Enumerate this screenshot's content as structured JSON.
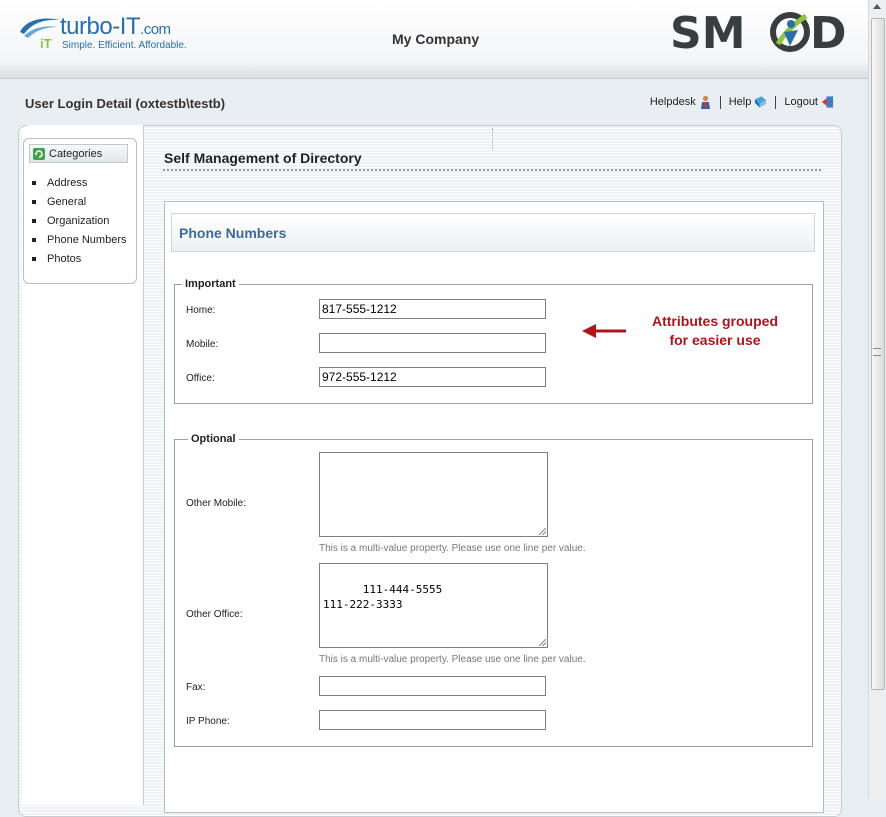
{
  "header": {
    "logo_name": "turbo-",
    "logo_it": "IT",
    "logo_domain": ".com",
    "logo_tagline": "Simple.  Efficient.  Affordable.",
    "company": "My Company",
    "product_logo": "SMOD"
  },
  "userline": "User Login Detail (oxtestb\\testb)",
  "toplinks": {
    "helpdesk": "Helpdesk",
    "help": "Help",
    "logout": "Logout"
  },
  "sidebar": {
    "title": "Categories",
    "items": [
      "Address",
      "General",
      "Organization",
      "Phone Numbers",
      "Photos"
    ]
  },
  "main": {
    "title": "Self Management of Directory",
    "section": "Phone Numbers",
    "important": {
      "legend": "Important",
      "home_label": "Home:",
      "home_value": "817-555-1212",
      "mobile_label": "Mobile:",
      "mobile_value": "",
      "office_label": "Office:",
      "office_value": "972-555-1212"
    },
    "optional": {
      "legend": "Optional",
      "other_mobile_label": "Other Mobile:",
      "other_mobile_value": "",
      "other_office_label": "Other Office:",
      "other_office_value": "111-444-5555\n111-222-3333",
      "hint": "This is a multi-value property. Please use one line per value.",
      "fax_label": "Fax:",
      "fax_value": "",
      "ip_phone_label": "IP Phone:",
      "ip_phone_value": ""
    }
  },
  "callout": {
    "line1": "Attributes grouped",
    "line2": "for easier use",
    "color": "#b0141a"
  },
  "colors": {
    "section_title": "#3b6b97",
    "brand_blue": "#2a6fa8"
  }
}
